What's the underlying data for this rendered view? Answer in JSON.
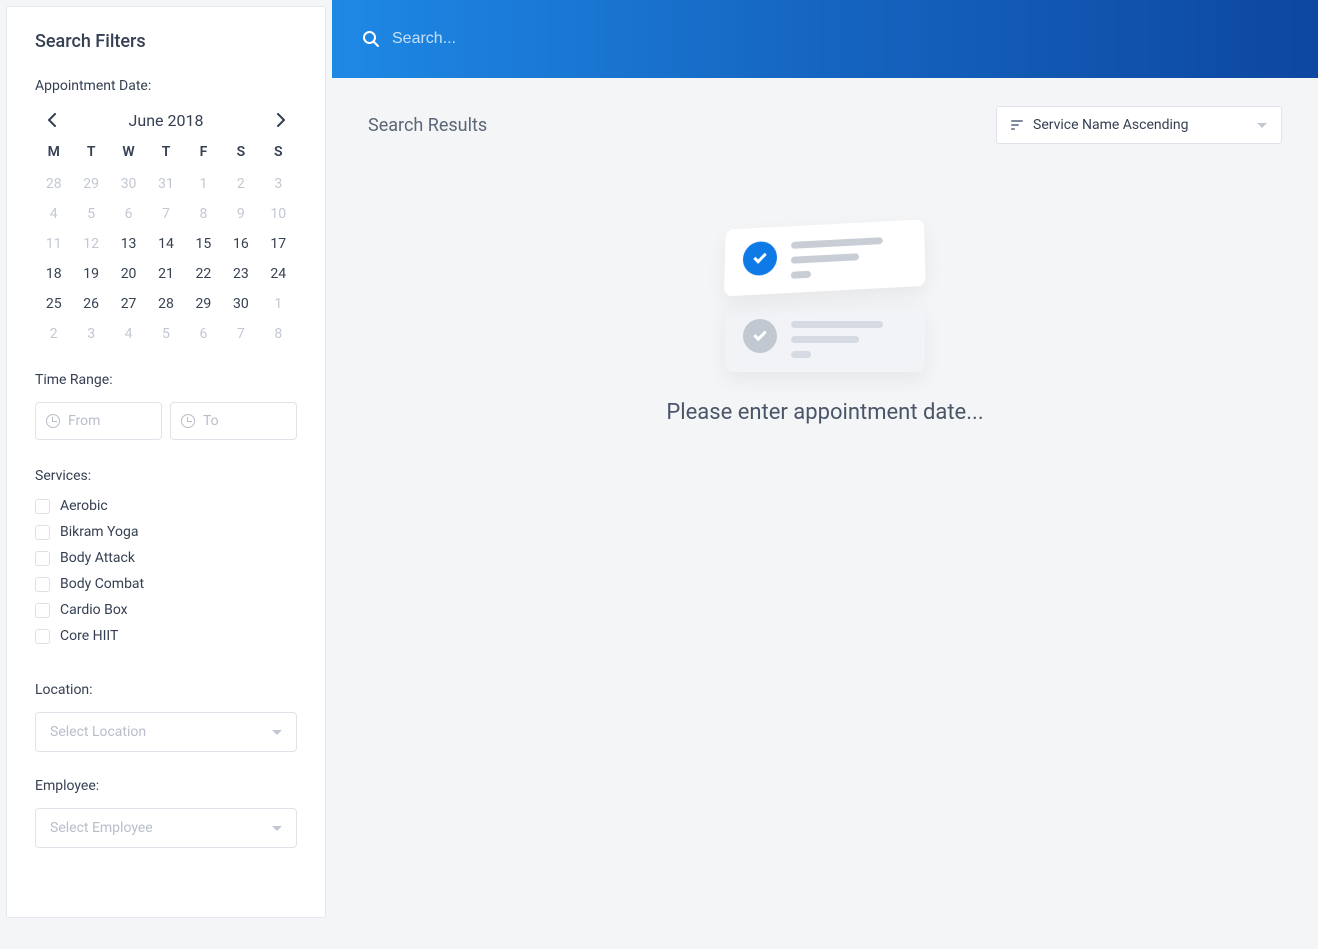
{
  "sidebar": {
    "title": "Search Filters",
    "appointment_date_label": "Appointment Date:",
    "calendar": {
      "month_title": "June 2018",
      "dow": [
        "M",
        "T",
        "W",
        "T",
        "F",
        "S",
        "S"
      ],
      "weeks": [
        [
          {
            "d": "28",
            "o": true
          },
          {
            "d": "29",
            "o": true
          },
          {
            "d": "30",
            "o": true
          },
          {
            "d": "31",
            "o": true
          },
          {
            "d": "1",
            "dis": true
          },
          {
            "d": "2",
            "dis": true
          },
          {
            "d": "3",
            "dis": true
          }
        ],
        [
          {
            "d": "4",
            "dis": true
          },
          {
            "d": "5",
            "dis": true
          },
          {
            "d": "6",
            "dis": true
          },
          {
            "d": "7",
            "dis": true
          },
          {
            "d": "8",
            "dis": true
          },
          {
            "d": "9",
            "dis": true
          },
          {
            "d": "10",
            "dis": true
          }
        ],
        [
          {
            "d": "11",
            "dis": true
          },
          {
            "d": "12",
            "dis": true
          },
          {
            "d": "13"
          },
          {
            "d": "14"
          },
          {
            "d": "15"
          },
          {
            "d": "16"
          },
          {
            "d": "17"
          }
        ],
        [
          {
            "d": "18"
          },
          {
            "d": "19"
          },
          {
            "d": "20"
          },
          {
            "d": "21"
          },
          {
            "d": "22"
          },
          {
            "d": "23"
          },
          {
            "d": "24"
          }
        ],
        [
          {
            "d": "25"
          },
          {
            "d": "26"
          },
          {
            "d": "27"
          },
          {
            "d": "28"
          },
          {
            "d": "29"
          },
          {
            "d": "30"
          },
          {
            "d": "1",
            "o": true
          }
        ],
        [
          {
            "d": "2",
            "o": true
          },
          {
            "d": "3",
            "o": true
          },
          {
            "d": "4",
            "o": true
          },
          {
            "d": "5",
            "o": true
          },
          {
            "d": "6",
            "o": true
          },
          {
            "d": "7",
            "o": true
          },
          {
            "d": "8",
            "o": true
          }
        ]
      ]
    },
    "time_range_label": "Time Range:",
    "time_from_placeholder": "From",
    "time_to_placeholder": "To",
    "services_label": "Services:",
    "services": [
      "Aerobic",
      "Bikram Yoga",
      "Body Attack",
      "Body Combat",
      "Cardio Box",
      "Core HIIT"
    ],
    "location_label": "Location:",
    "location_placeholder": "Select Location",
    "employee_label": "Employee:",
    "employee_placeholder": "Select Employee"
  },
  "main": {
    "search_placeholder": "Search...",
    "results_title": "Search Results",
    "sort_label": "Service Name Ascending",
    "empty_text": "Please enter appointment date..."
  }
}
